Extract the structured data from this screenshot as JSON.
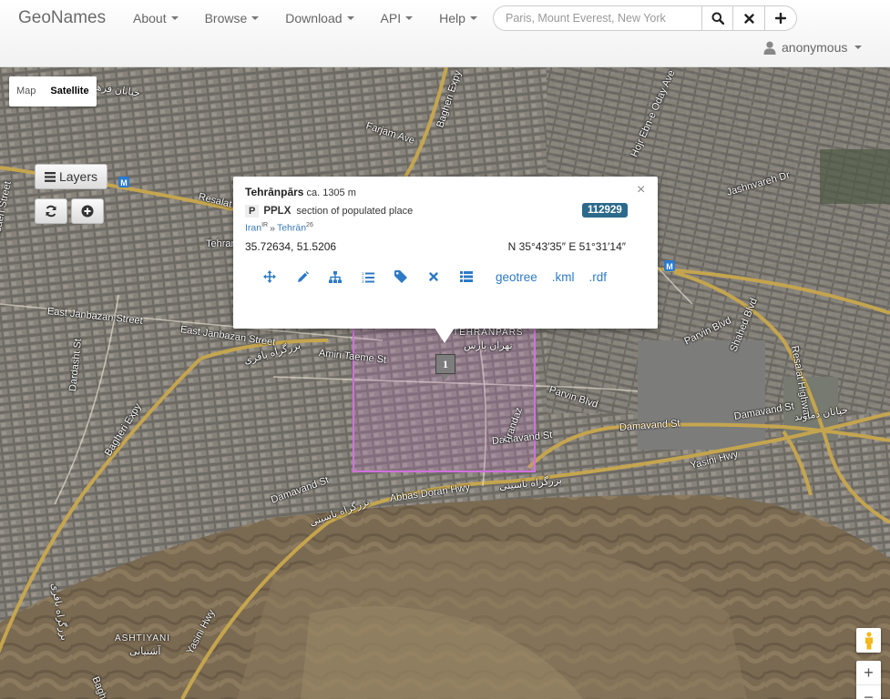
{
  "navbar": {
    "brand": "GeoNames",
    "menu": [
      {
        "label": "About"
      },
      {
        "label": "Browse"
      },
      {
        "label": "Download"
      },
      {
        "label": "API"
      },
      {
        "label": "Help"
      }
    ],
    "search_placeholder": "Paris, Mount Everest, New York",
    "user": "anonymous"
  },
  "map": {
    "map_types": [
      "Map",
      "Satellite"
    ],
    "active_map_type": "Satellite",
    "layers_label": "Layers",
    "marker_label": "1",
    "zoom_in": "+",
    "zoom_out": "−",
    "streets": {
      "khiaban_farhad": "خیابان فرهاد",
      "bagheri_expy_n": "Bagheri Expy",
      "farjam_ave": "Farjam Ave",
      "hoj_ebn_e_oday": "Hojr Ebn-e Oday Ave",
      "madain": "Madaen Street",
      "resalat": "Resalat",
      "jashnvareh": "Jashnvareh Dr",
      "tehran_east": "Tehran East",
      "east_janbazan_1": "East Janbazan Street",
      "east_janbazan_2": "East Janbazan Street",
      "bozorgrah_bagheri": "بزرگراه باقری",
      "amiri_taeme": "Amiri Taeme St",
      "tehranpars": "TEHRANPARS",
      "tehranpars_fa": "تهران پارس",
      "dardasht": "Dardasht St",
      "bagheri_expy_w": "Bagheri Expy",
      "parvin_blvd_1": "Parvin Blvd",
      "parvin_blvd_2": "Parvin Blvd",
      "shahed_blvd": "Shahed Blvd",
      "resalat_hwy": "Resalat Highway",
      "damavand_st_1": "Damavand St",
      "damavand_st_2": "Damavand St",
      "damavand_st_3": "Damavand St",
      "khiaban_damavand": "خیابان دماوند",
      "tirandaz": "Tirandaz",
      "yasini_hwy": "Yasini Hwy",
      "bozorgrah_yasini_1": "بزرگراه یاسینی",
      "bozorgrah_yasini_2": "بزرگراه یاسینی",
      "abbas_doran": "Abbas Doran Hwy",
      "ashtiyani": "ASHTIYANI",
      "ashtiyani_fa": "آشتیانی",
      "yasini_hwy_s": "Yasini Hwy",
      "bagheri_s": "Bagheri",
      "bozorgrah_fa_w": "بزرگراه باقری"
    }
  },
  "popup": {
    "name": "Tehrānpārs",
    "elevation": "ca. 1305 m",
    "feature_class": "P",
    "feature_code": "PPLX",
    "feature_desc": "section of populated place",
    "id_badge": "112929",
    "country": "Iran",
    "country_code": "IR",
    "hierarchy_sep": "»",
    "admin1": "Tehrān",
    "admin1_code": "26",
    "coords_decimal": "35.72634, 51.5206",
    "coords_dms": "N 35°43′35″ E 51°31′14″",
    "links": [
      "geotree",
      ".kml",
      ".rdf"
    ]
  },
  "icons": {
    "close": "×"
  }
}
